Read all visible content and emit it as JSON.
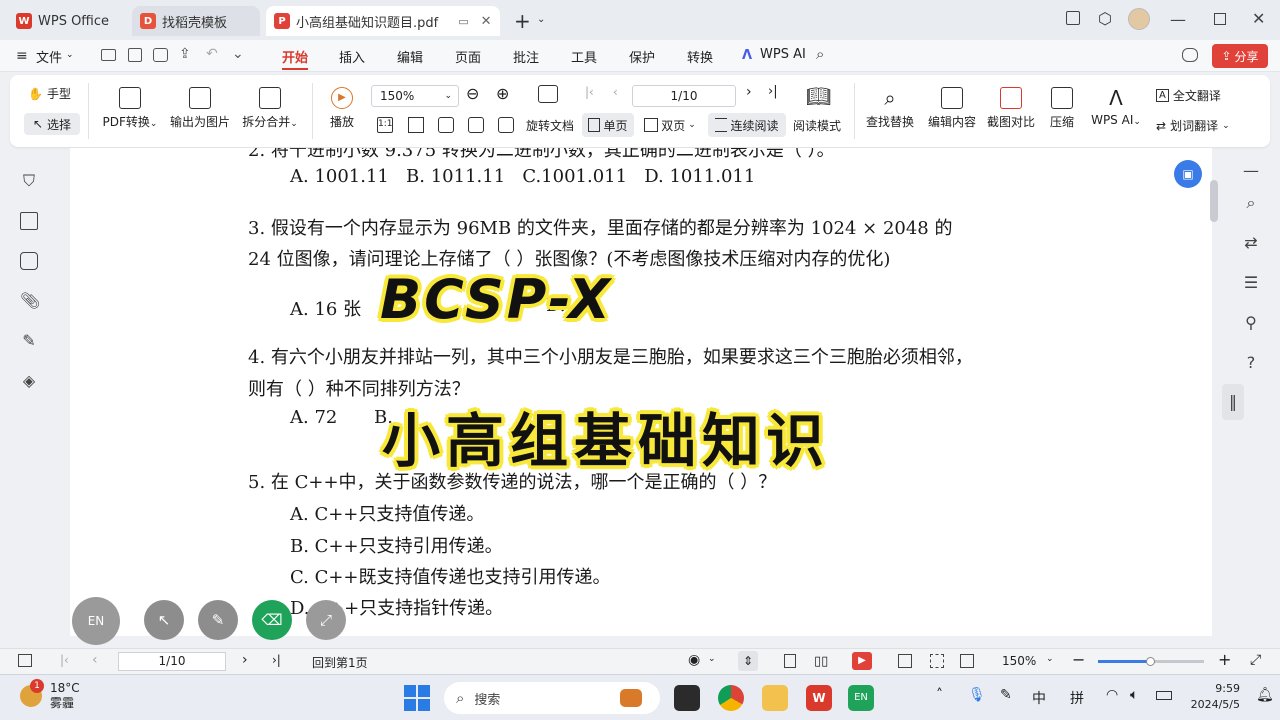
{
  "tabs": [
    {
      "label": "WPS Office",
      "icon": "wps-logo-icon"
    },
    {
      "label": "找稻壳模板",
      "icon": "docer-icon"
    },
    {
      "label": "小高组基础知识题目.pdf",
      "icon": "pdf-icon"
    }
  ],
  "menu": {
    "file_label": "文件",
    "items": [
      "开始",
      "插入",
      "编辑",
      "页面",
      "批注",
      "工具",
      "保护",
      "转换"
    ],
    "active": "开始",
    "wps_ai_label": "WPS AI",
    "share_label": "分享"
  },
  "ribbon": {
    "hand_label": "手型",
    "select_label": "选择",
    "pdf_convert_label": "PDF转换",
    "export_image_label": "输出为图片",
    "split_merge_label": "拆分合并",
    "play_label": "播放",
    "zoom_value": "150%",
    "page_value": "1/10",
    "rotate_label": "旋转文档",
    "single_page_label": "单页",
    "double_page_label": "双页",
    "continuous_label": "连续阅读",
    "read_mode_label": "阅读模式",
    "find_replace_label": "查找替换",
    "edit_content_label": "编辑内容",
    "screenshot_compare_label": "截图对比",
    "compress_label": "压缩",
    "wps_ai_label": "WPS AI",
    "full_translate_label": "全文翻译",
    "word_translate_label": "划词翻译"
  },
  "document": {
    "line_cut": "2. 将十进制小数 9.375 转换为二进制小数，其正确的二进制表示是（ ）。",
    "q2_options": "A. 1001.11   B. 1011.11   C.1001.011   D. 1011.011",
    "q3_line1": "3.  假设有一个内存显示为 96MB 的文件夹，里面存储的都是分辨率为 1024 × 2048 的",
    "q3_line2": "24 位图像，请问理论上存储了（ ）张图像？(不考虑图像技术压缩对内存的优化)",
    "q3_options": "A.  16 张",
    "q3_options_d": "D.",
    "q4_line1": "4.  有六个小朋友并排站一列，其中三个小朋友是三胞胎，如果要求这三个三胞胎必须相邻，",
    "q4_line2": "则有（ ）种不同排列方法？",
    "q4_options_a": "A.  72",
    "q4_options_b": "B.",
    "q5_line1": "5.  在 C++中，关于函数参数传递的说法，哪一个是正确的（ ）？",
    "q5_a": "A.  C++只支持值传递。",
    "q5_b": "B.  C++只支持引用传递。",
    "q5_c": "C.  C++既支持值传递也支持引用传递。",
    "q5_d": "D.  C++只支持指针传递。"
  },
  "overlay": {
    "title": "BCSP-X",
    "subtitle": "小高组基础知识"
  },
  "floating_tools": {
    "lang_label": "EN"
  },
  "statusbar": {
    "page_value": "1/10",
    "back_first_label": "回到第1页",
    "zoom_value": "150%"
  },
  "taskbar": {
    "weather_temp": "18°C",
    "weather_desc": "雾霾",
    "weather_badge": "1",
    "search_placeholder": "搜索",
    "ime_lang": "中",
    "ime_mode": "拼",
    "time": "9:59",
    "date": "2024/5/5",
    "en_badge": "EN"
  },
  "colors": {
    "accent_red": "#d93a2c",
    "overlay_yellow": "#f7e83a",
    "tool_green": "#1fa35a"
  }
}
